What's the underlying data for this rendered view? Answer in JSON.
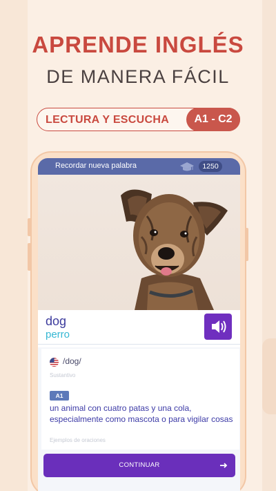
{
  "promo": {
    "headline": "APRENDE INGLÉS",
    "subheadline": "DE MANERA FÁCIL",
    "pill_label": "LECTURA Y ESCUCHA",
    "pill_level": "A1 - C2"
  },
  "app": {
    "topbar": {
      "title": "Recordar nueva palabra",
      "cap_icon": "graduation-cap-icon",
      "score": "1250"
    },
    "card": {
      "image": "dog-photo",
      "word": "dog",
      "translation": "perro",
      "speaker_icon": "speaker-icon",
      "flag_icon": "us-flag-icon",
      "phonetic": "/dog/",
      "part_of_speech": "Sustantivo",
      "level": "A1",
      "definition": "un animal con cuatro patas y una cola, especialmente como mascota o para vigilar cosas",
      "examples_label": "Ejemplos de oraciones"
    },
    "continue_label": "CONTINUAR",
    "arrow_icon": "arrow-right-icon"
  },
  "colors": {
    "accent_red": "#c9493f",
    "topbar_blue": "#5a6aa8",
    "button_purple": "#6a2fbb",
    "word_color": "#3b3a9c",
    "translation_color": "#35b7d3",
    "phone_peach": "#fbe0c8"
  }
}
